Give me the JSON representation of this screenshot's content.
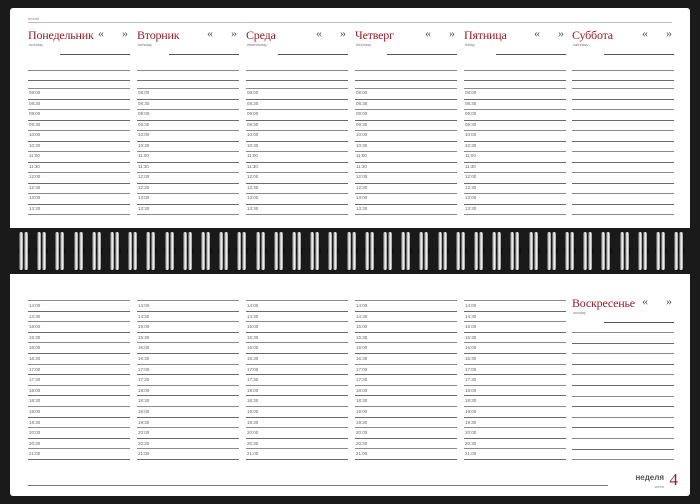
{
  "header": {
    "month_label": "month"
  },
  "week": {
    "label": "неделя",
    "sublabel": "week",
    "number": "4"
  },
  "nav": {
    "prev": "«",
    "next": "»"
  },
  "top_days": [
    {
      "title": "Понедельник",
      "sub": "monday",
      "times": [
        "08:00",
        "08:30",
        "09:00",
        "09:30",
        "10:00",
        "10:30",
        "11:00",
        "11:30",
        "12:00",
        "12:30",
        "13:00",
        "13:30"
      ]
    },
    {
      "title": "Вторник",
      "sub": "tuesday",
      "times": [
        "08:00",
        "08:30",
        "09:00",
        "09:30",
        "10:00",
        "10:30",
        "11:00",
        "11:30",
        "12:00",
        "12:30",
        "13:00",
        "13:30"
      ]
    },
    {
      "title": "Среда",
      "sub": "wednesday",
      "times": [
        "08:00",
        "08:30",
        "09:00",
        "09:30",
        "10:00",
        "10:30",
        "11:00",
        "11:30",
        "12:00",
        "12:30",
        "13:00",
        "13:30"
      ]
    },
    {
      "title": "Четверг",
      "sub": "thursday",
      "times": [
        "08:00",
        "08:30",
        "09:00",
        "09:30",
        "10:00",
        "10:30",
        "11:00",
        "11:30",
        "12:00",
        "12:30",
        "13:00",
        "13:30"
      ]
    },
    {
      "title": "Пятница",
      "sub": "friday",
      "times": [
        "08:00",
        "08:30",
        "09:00",
        "09:30",
        "10:00",
        "10:30",
        "11:00",
        "11:30",
        "12:00",
        "12:30",
        "13:00",
        "13:30"
      ]
    },
    {
      "title": "Суббота",
      "sub": "saturday",
      "times": []
    }
  ],
  "bottom_times": [
    "14:00",
    "14:30",
    "15:00",
    "15:30",
    "16:00",
    "16:30",
    "17:00",
    "17:30",
    "18:00",
    "18:30",
    "19:00",
    "19:30",
    "20:00",
    "20:30",
    "21:00"
  ],
  "sunday": {
    "title": "Воскресенье",
    "sub": "sunday"
  },
  "colors": {
    "accent": "#9b1b27",
    "background": "#1a1a1a",
    "paper": "#ffffff"
  }
}
